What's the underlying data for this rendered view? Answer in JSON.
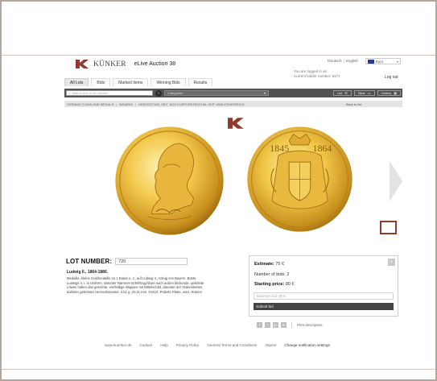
{
  "brand": {
    "logo_text": "KÜNKER",
    "auction_title": "eLive Auction 38"
  },
  "header": {
    "lang_de": "Deutsch",
    "lang_en": "english",
    "currency": "Euro",
    "login_line1": "You are logged in as",
    "login_line2": "Current bidder number: 6171",
    "logout_label": "Log out"
  },
  "tabs": [
    {
      "label": "All Lots",
      "active": true
    },
    {
      "label": "Bids",
      "active": false
    },
    {
      "label": "Marked Items",
      "active": false
    },
    {
      "label": "Winning Bids",
      "active": false
    },
    {
      "label": "Results",
      "active": false
    }
  ],
  "toolbar": {
    "search_placeholder": "Search text or lot number",
    "category_label": "Categories",
    "view_list": "List",
    "view_slide": "Slide",
    "view_gallery": "Gallery"
  },
  "breadcrumb": {
    "items": [
      "GERMAN COINS AND MEDALS",
      "BAVARIA",
      "HERZOGTUM, SEIT 1623 KURFÜRSTENTUM, SEIT 1806 KÖNIGREICH"
    ],
    "back_label": "Back to list"
  },
  "coin_right": {
    "year_left": "1845",
    "year_right": "1864"
  },
  "lot": {
    "label": "LOT NUMBER:",
    "number": "720",
    "name": "Ludwig II., 1864-1886.",
    "description": "Medaille, kleine Goldmedaille zu 1 Dukat o. J., auf Ludwig II., König von Bayern. Büste Ludwigs II. r. in Uniform, darunter Namens-Schriftzug//Zwei nach außen blickende, gekrönte Löwen halten das gekrönte, vierfeldige Wappen mit Mittelschild, darunter der Ordensketten, dahinter gekrönter Hermelinmantel. 3,51 g. 20,11 mm. GOLD. Polierte Platte, winz. Kratzer"
  },
  "bid": {
    "estimate_label": "Estimate:",
    "estimate_value": "75 €",
    "bids_label": "Number of bids:",
    "bids_value": "2",
    "start_label": "Starting price:",
    "start_value": "80 €",
    "input_placeholder": "Minimum bid: 85 €",
    "submit_label": "Submit bid"
  },
  "share": {
    "icons": [
      "f",
      "t",
      "g+",
      "✉"
    ],
    "print_label": "Print description"
  },
  "footer": {
    "links": [
      "www.kuenker.de",
      "Contact",
      "Help",
      "Privacy Policy",
      "General Terms and Conditions",
      "Imprint"
    ],
    "settings_label": "Change notification settings"
  },
  "colors": {
    "brand_red": "#8e3c30",
    "gold_light": "#f6d874",
    "gold_dark": "#b57c14",
    "toolbar": "#525252"
  }
}
